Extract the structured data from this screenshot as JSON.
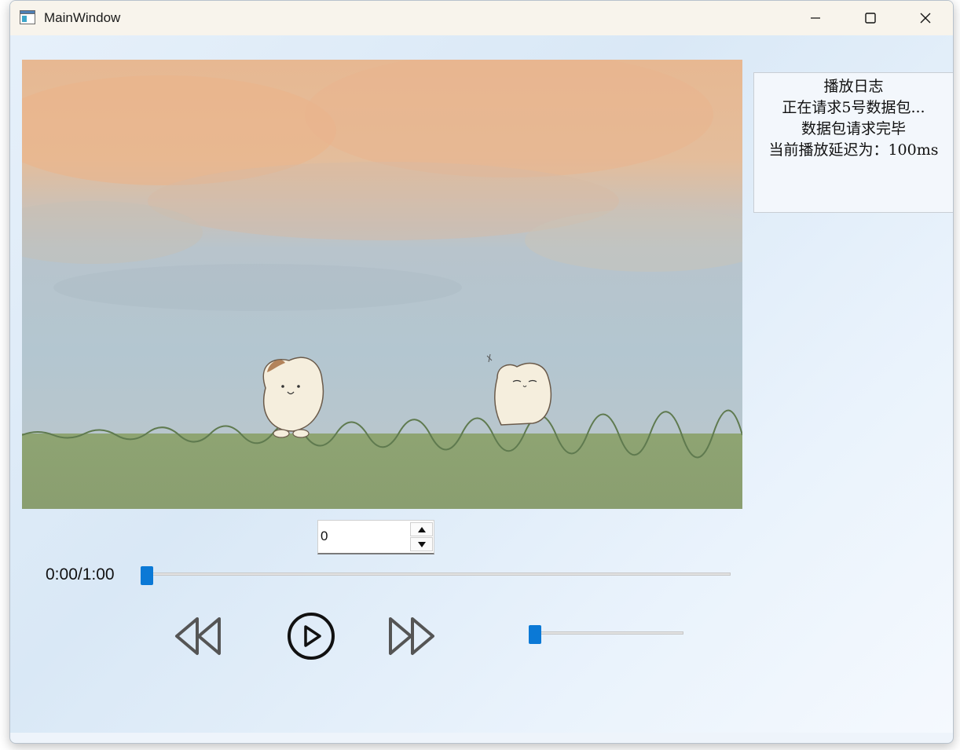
{
  "window": {
    "title": "MainWindow"
  },
  "log": {
    "title": "播放日志",
    "lines": [
      "正在请求5号数据包...",
      "数据包请求完毕",
      "当前播放延迟为：100ms"
    ]
  },
  "spinbox": {
    "value": "0"
  },
  "player": {
    "time": "0:00/1:00",
    "progress": 0,
    "volume": 0
  },
  "icons": {
    "app": "window-app-icon",
    "minimize": "minimize-icon",
    "maximize": "maximize-icon",
    "close": "close-icon",
    "rewind": "rewind-icon",
    "play": "play-icon",
    "fast_forward": "fast-forward-icon"
  },
  "colors": {
    "accent": "#0b79d6",
    "titlebar": "#f8f4ec"
  }
}
